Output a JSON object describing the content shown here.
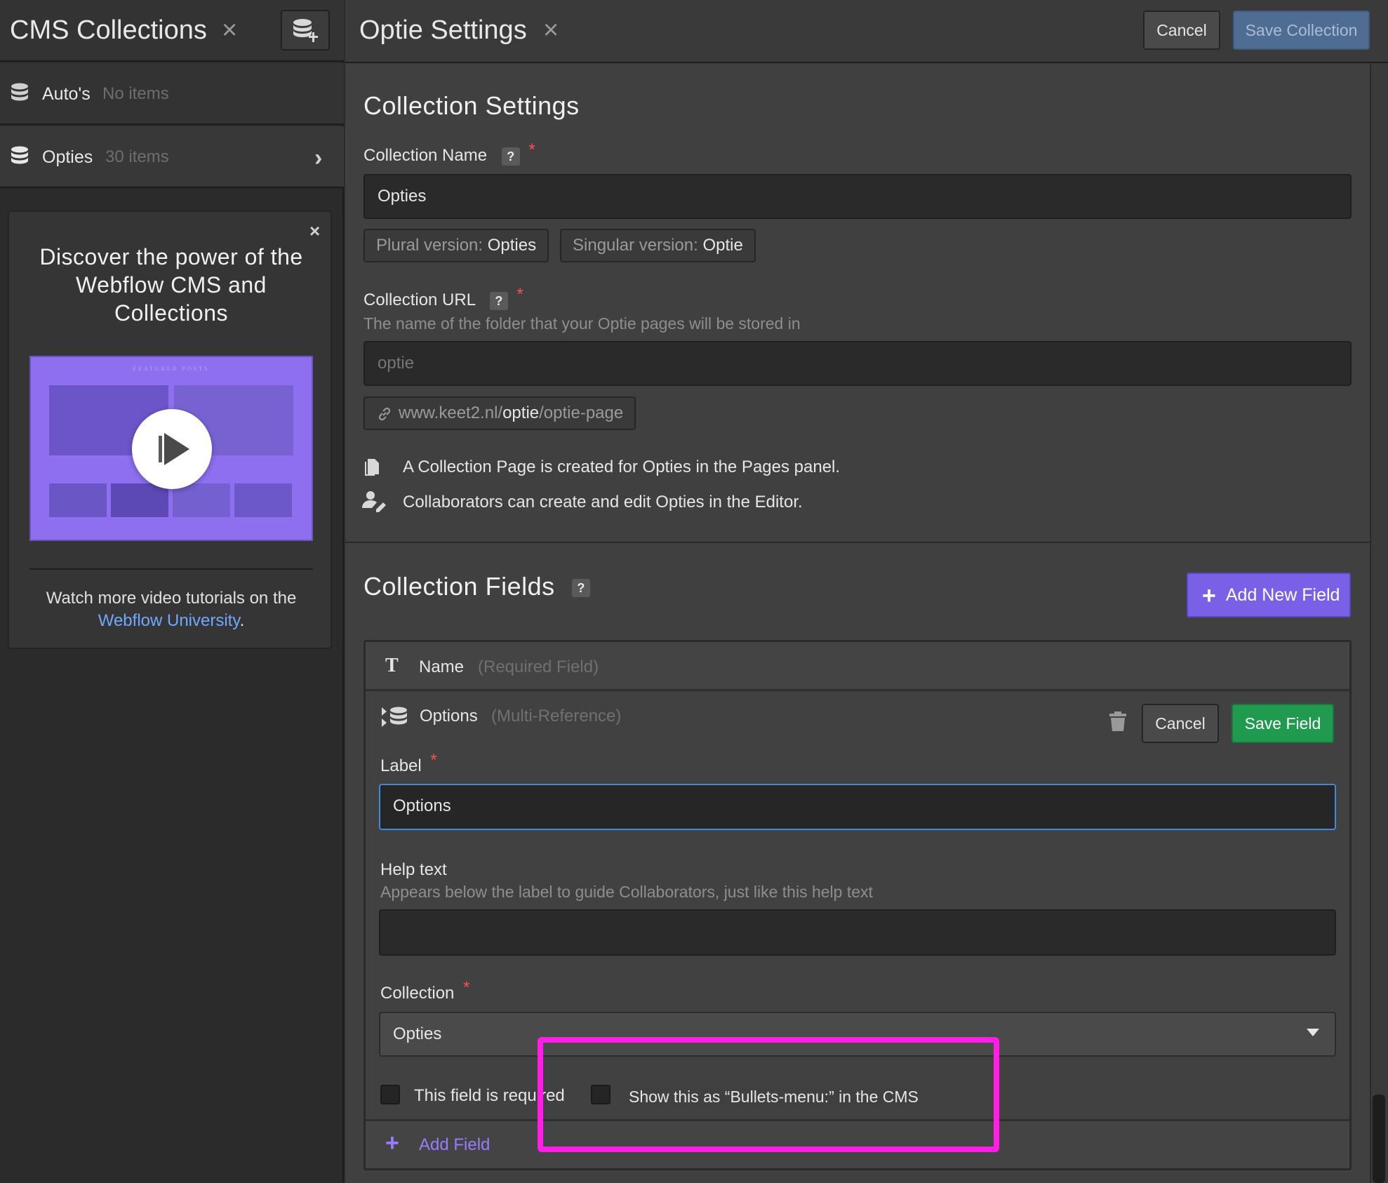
{
  "sidebar": {
    "title": "CMS Collections",
    "close_glyph": "×",
    "add_icon": "database-plus-icon",
    "collections": [
      {
        "name": "Auto's",
        "count": "No items"
      },
      {
        "name": "Opties",
        "count": "30 items",
        "chevron": "›"
      }
    ],
    "promo": {
      "close_glyph": "×",
      "title": "Discover the power of the Webflow CMS and Collections",
      "text": "Watch more video tutorials on the",
      "link": "Webflow University",
      "period": ".",
      "video_icon": "play-icon",
      "video_text": "FEATURED POSTS"
    }
  },
  "header": {
    "title": "Optie Settings",
    "close_glyph": "×",
    "cancel_label": "Cancel",
    "save_label": "Save Collection"
  },
  "settings": {
    "section_title": "Collection Settings",
    "name_label": "Collection Name",
    "help": "?",
    "required": "*",
    "name_value": "Opties",
    "plural_label": "Plural version:",
    "plural_value": "Opties",
    "singular_label": "Singular version:",
    "singular_value": "Optie",
    "url_label": "Collection URL",
    "url_hint": "The name of the folder that your Optie pages will be stored in",
    "url_placeholder": "optie",
    "url_preview_domain": "www.keet2.nl/",
    "url_preview_slug": "optie",
    "url_preview_rest": "/optie-page",
    "info_page": "A Collection Page is created for Opties in the Pages panel.",
    "info_editor": "Collaborators can create and edit Opties in the Editor."
  },
  "fields": {
    "section_title": "Collection Fields",
    "help": "?",
    "add_new_label": "Add New Field",
    "name_field": {
      "name": "Name",
      "type": "(Required Field)"
    },
    "options_field": {
      "name": "Options",
      "type": "(Multi-Reference)",
      "cancel_label": "Cancel",
      "save_label": "Save Field",
      "label_label": "Label",
      "label_value": "Options",
      "help_label": "Help text",
      "help_hint": "Appears below the label to guide Collaborators, just like this help text",
      "help_value": "",
      "collection_label": "Collection",
      "collection_value": "Opties",
      "required_checkbox": "This field is required",
      "bullets_checkbox": "Show this as “Bullets-menu:” in the CMS"
    },
    "add_field_label": "Add Field"
  },
  "colors": {
    "accent": "#7a60e6",
    "save_green": "#1f9a4e",
    "highlight": "#ff1ee6",
    "link": "#6fa8ff",
    "required": "#ff4d4d"
  }
}
